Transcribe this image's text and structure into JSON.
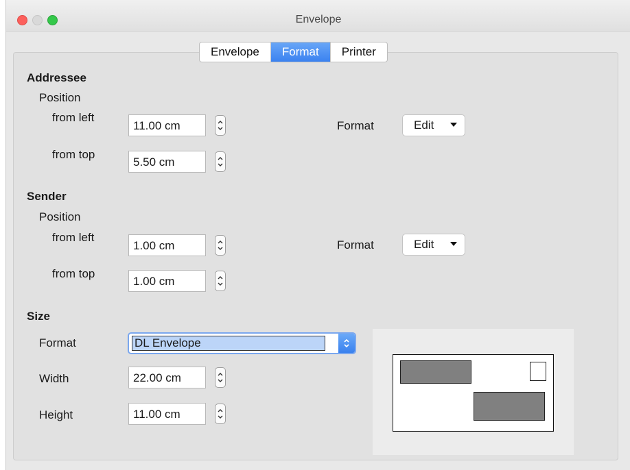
{
  "window": {
    "title": "Envelope"
  },
  "tabs": [
    {
      "label": "Envelope",
      "active": false
    },
    {
      "label": "Format",
      "active": true
    },
    {
      "label": "Printer",
      "active": false
    }
  ],
  "addressee": {
    "heading": "Addressee",
    "position_label": "Position",
    "from_left_label": "from left",
    "from_left_value": "11.00 cm",
    "from_top_label": "from top",
    "from_top_value": "5.50 cm",
    "format_label": "Format",
    "edit_label": "Edit"
  },
  "sender": {
    "heading": "Sender",
    "position_label": "Position",
    "from_left_label": "from left",
    "from_left_value": "1.00 cm",
    "from_top_label": "from top",
    "from_top_value": "1.00 cm",
    "format_label": "Format",
    "edit_label": "Edit"
  },
  "size": {
    "heading": "Size",
    "format_label": "Format",
    "format_value": "DL Envelope",
    "width_label": "Width",
    "width_value": "22.00 cm",
    "height_label": "Height",
    "height_value": "11.00 cm"
  },
  "colors": {
    "accent": "#3b82f0",
    "preview_fill": "#808080"
  }
}
